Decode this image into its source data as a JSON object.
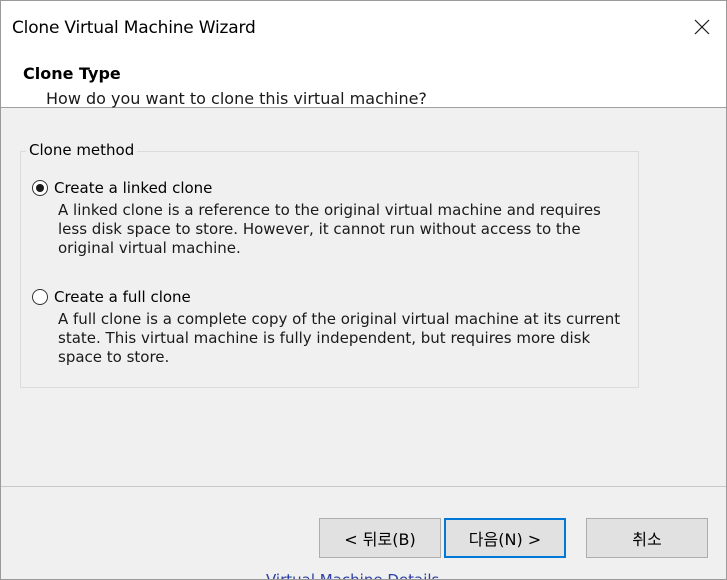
{
  "window": {
    "title": "Clone Virtual Machine Wizard",
    "close_icon": "close-icon"
  },
  "header": {
    "title": "Clone Type",
    "subtitle": "How do you want to clone this virtual machine?"
  },
  "clone_method": {
    "group_label": "Clone method",
    "selected": "linked",
    "options": [
      {
        "id": "linked",
        "label": "Create a linked clone",
        "checked": true,
        "description": "A linked clone is a reference to the original virtual machine and requires less disk space to store. However, it cannot run without access to the original virtual machine."
      },
      {
        "id": "full",
        "label": "Create a full clone",
        "checked": false,
        "description": "A full clone is a complete copy of the original virtual machine at its current state. This virtual machine is fully independent, but requires more disk space to store."
      }
    ]
  },
  "buttons": {
    "back_label": "< 뒤로(B)",
    "next_label": "다음(N) >",
    "cancel_label": "취소"
  },
  "background": {
    "partial_text": "Virtual Machine Details"
  },
  "colors": {
    "accent": "#0078d7",
    "dialog_bg": "#f0f0f0",
    "header_bg": "#ffffff"
  }
}
